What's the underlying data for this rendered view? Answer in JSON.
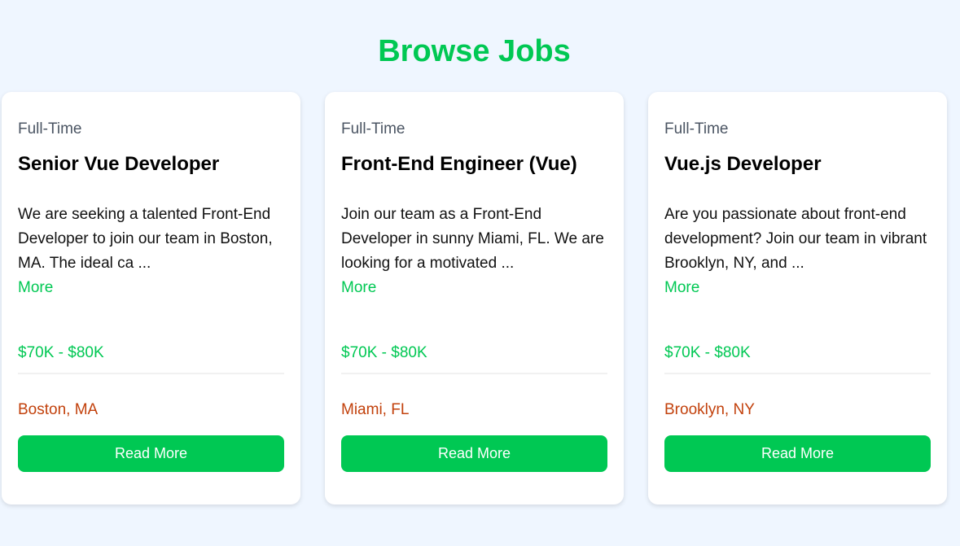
{
  "page": {
    "title": "Browse Jobs"
  },
  "colors": {
    "accent": "#00c853",
    "location": "#c2410c",
    "background": "#eff6ff"
  },
  "jobs": [
    {
      "type": "Full-Time",
      "title": "Senior Vue Developer",
      "description": "We are seeking a talented Front-End Developer to join our team in Boston, MA. The ideal ca ...",
      "more_label": "More",
      "salary": "$70K - $80K",
      "location": "Boston, MA",
      "button_label": "Read More"
    },
    {
      "type": "Full-Time",
      "title": "Front-End Engineer (Vue)",
      "description": "Join our team as a Front-End Developer in sunny Miami, FL. We are looking for a motivated ...",
      "more_label": "More",
      "salary": "$70K - $80K",
      "location": "Miami, FL",
      "button_label": "Read More"
    },
    {
      "type": "Full-Time",
      "title": "Vue.js Developer",
      "description": "Are you passionate about front-end development? Join our team in vibrant Brooklyn, NY, and ...",
      "more_label": "More",
      "salary": "$70K - $80K",
      "location": "Brooklyn, NY",
      "button_label": "Read More"
    }
  ]
}
